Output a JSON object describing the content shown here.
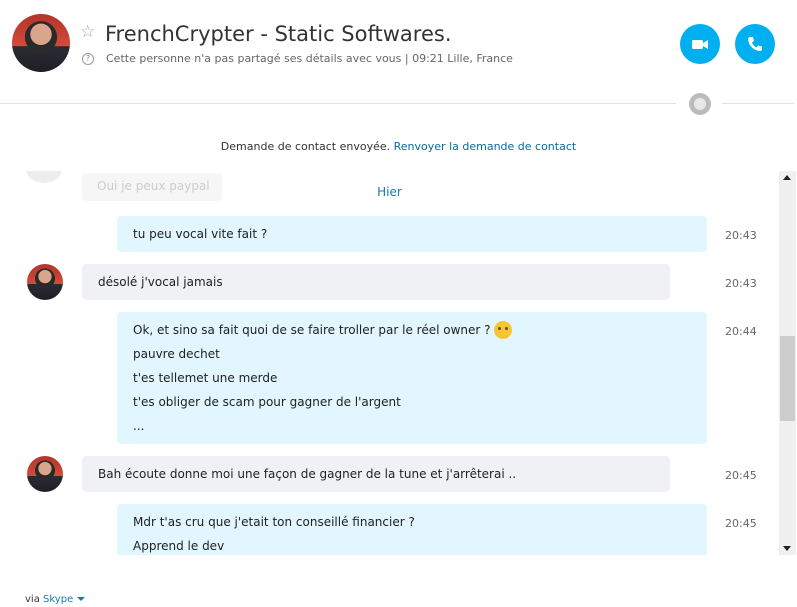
{
  "header": {
    "title": "FrenchCrypter - Static Softwares.",
    "subtitle": "Cette personne n'a pas partagé ses détails avec vous  |  09:21 Lille, France",
    "video_call_icon": "video-camera-icon",
    "audio_call_icon": "phone-icon",
    "accent": "#00aff0"
  },
  "contact_request": {
    "text": "Demande de contact envoyée. ",
    "link": "Renvoyer la demande de contact"
  },
  "chat": {
    "faded_message": "Oui je peux paypal",
    "day_separator": "Hier",
    "messages": [
      {
        "direction": "outgoing",
        "time": "20:43",
        "lines": [
          "tu peu vocal vite fait ?"
        ]
      },
      {
        "direction": "incoming",
        "time": "20:43",
        "lines": [
          "désolé j'vocal jamais"
        ]
      },
      {
        "direction": "outgoing",
        "time": "20:44",
        "lines": [
          "Ok, et sino sa fait quoi de se faire troller par le réel owner ?",
          "pauvre dechet",
          "t'es tellemet une merde",
          "t'es obliger de scam pour gagner de l'argent",
          "..."
        ]
      },
      {
        "direction": "incoming",
        "time": "20:45",
        "lines": [
          "Bah écoute donne moi une façon de gagner de la tune et j'arrêterai .."
        ]
      },
      {
        "direction": "outgoing",
        "time": "20:45",
        "lines": [
          "Mdr t'as cru que j'etait ton conseillé financier ?",
          "Apprend le dev"
        ]
      }
    ]
  },
  "footer": {
    "via": "via ",
    "link": "Skype"
  }
}
